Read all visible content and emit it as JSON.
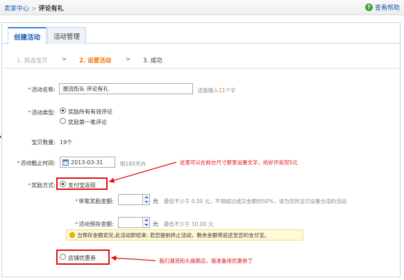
{
  "breadcrumb": {
    "root": "卖家中心",
    "separator": ">",
    "current": "评论有礼"
  },
  "help": {
    "icon": "question-icon",
    "label": "查看帮助"
  },
  "tabs": [
    {
      "label": "创建活动",
      "active": true
    },
    {
      "label": "活动管理",
      "active": false
    }
  ],
  "steps": {
    "step1": "1. 挑选宝贝",
    "arrow": ">",
    "step2": "2. 设置活动",
    "step3": "3. 成功"
  },
  "form": {
    "name": {
      "required": "*",
      "label": "活动名称:",
      "value": "潮流衔头 评论有礼",
      "hint_prefix": "还能输入",
      "hint_count": "11",
      "hint_suffix": "个字"
    },
    "type": {
      "required": "*",
      "label": "活动类型:",
      "options": [
        "奖励所有有效评论",
        "奖励第一笔评论"
      ],
      "selected_index": 0
    },
    "count": {
      "label": "宝贝数量:",
      "value": "19个"
    },
    "deadline": {
      "required": "*",
      "label": "活动截止时间:",
      "value": "2013-03-31",
      "hint": "限180天内"
    },
    "reward": {
      "required": "*",
      "label": "奖励方式:",
      "option_alipay": "支付宝返现",
      "option_coupon": "店铺优惠券",
      "single": {
        "required": "*",
        "label": "单笔奖励金额:",
        "unit": "元",
        "hint": "最低不少于 0.50 元，不得超过成交金额的50%，请为您的宝贝设置合适的活动"
      },
      "deposit": {
        "required": "*",
        "label": "活动预存金额:",
        "unit": "元",
        "hint": "最低不少于 10.00 元"
      },
      "notice": "当预存金额奖完,此活动即结束; 若您提前终止活动，剩余金额将返还至您的支付宝。"
    }
  },
  "annotations": {
    "note1": "这里可以在前台尺寸那里设置文字，给好评返现5元",
    "note2": "我们潮流衔头旗舰店，我准备用优惠券了",
    "color": "#e01010"
  }
}
